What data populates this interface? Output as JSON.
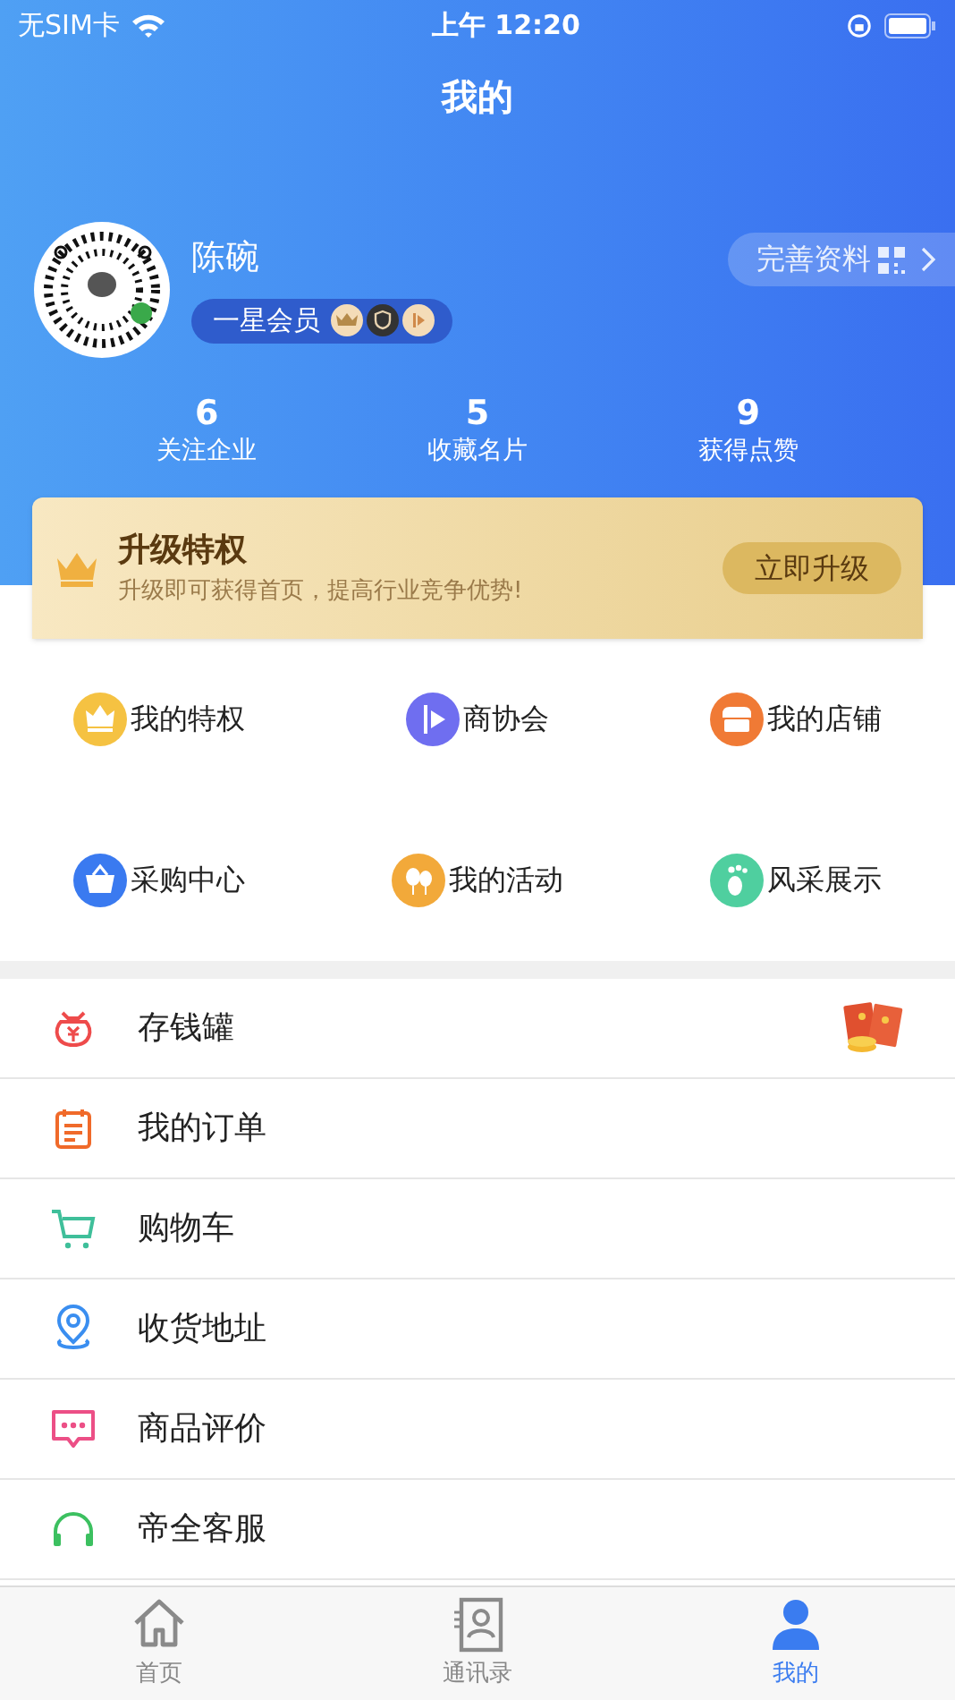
{
  "status_bar": {
    "carrier": "无SIM卡",
    "time": "上午 12:20"
  },
  "title": "我的",
  "profile": {
    "name": "陈碗",
    "member_level": "一星会员",
    "edit_button": "完善资料"
  },
  "stats": [
    {
      "value": "6",
      "label": "关注企业"
    },
    {
      "value": "5",
      "label": "收藏名片"
    },
    {
      "value": "9",
      "label": "获得点赞"
    }
  ],
  "upgrade_card": {
    "title": "升级特权",
    "subtitle": "升级即可获得首页，提高行业竞争优势!",
    "button": "立即升级"
  },
  "shortcuts": [
    {
      "label": "我的特权",
      "kind": "crown"
    },
    {
      "label": "商协会",
      "kind": "flag"
    },
    {
      "label": "我的店铺",
      "kind": "shop"
    },
    {
      "label": "采购中心",
      "kind": "basket"
    },
    {
      "label": "我的活动",
      "kind": "balloon"
    },
    {
      "label": "风采展示",
      "kind": "foot"
    }
  ],
  "menu": [
    {
      "label": "存钱罐",
      "kind": "moneybag",
      "badge": true
    },
    {
      "label": "我的订单",
      "kind": "order",
      "badge": false
    },
    {
      "label": "购物车",
      "kind": "cart",
      "badge": false
    },
    {
      "label": "收货地址",
      "kind": "location",
      "badge": false
    },
    {
      "label": "商品评价",
      "kind": "comment",
      "badge": false
    },
    {
      "label": "帝全客服",
      "kind": "headset",
      "badge": false
    }
  ],
  "tab_bar": [
    {
      "label": "首页",
      "kind": "home",
      "selected": false
    },
    {
      "label": "通讯录",
      "kind": "contacts",
      "selected": false
    },
    {
      "label": "我的",
      "kind": "person",
      "selected": true
    }
  ]
}
